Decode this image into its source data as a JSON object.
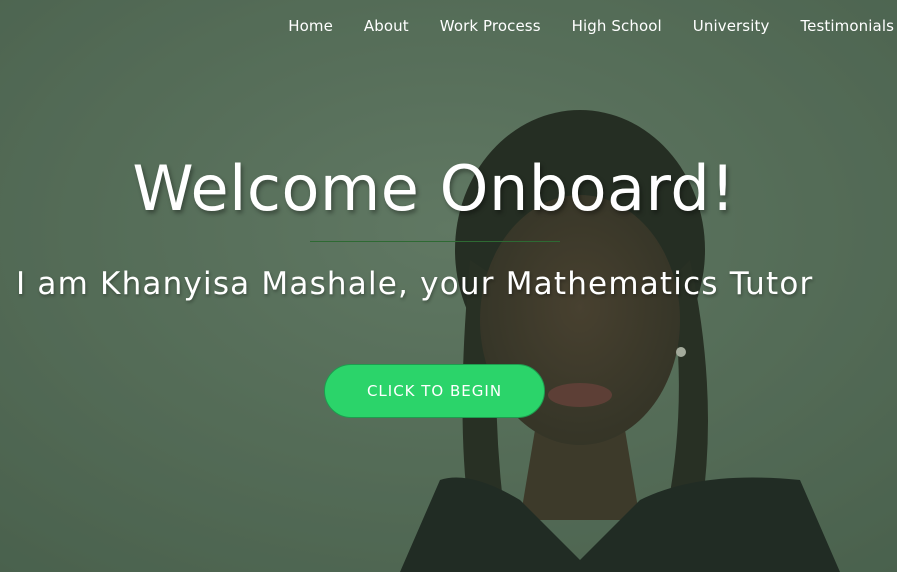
{
  "nav": {
    "items": [
      {
        "label": "Home"
      },
      {
        "label": "About"
      },
      {
        "label": "Work Process"
      },
      {
        "label": "High School"
      },
      {
        "label": "University"
      },
      {
        "label": "Testimonials"
      }
    ]
  },
  "hero": {
    "title": "Welcome Onboard!",
    "subtitle": "I am Khanyisa Mashale, your Mathematics Tutor",
    "cta_label": "CLICK TO BEGIN"
  },
  "colors": {
    "background": "#5a6d5b",
    "overlay": "#466449",
    "divider": "#2e6a33",
    "cta": "#2bd46a",
    "text": "#ffffff"
  }
}
